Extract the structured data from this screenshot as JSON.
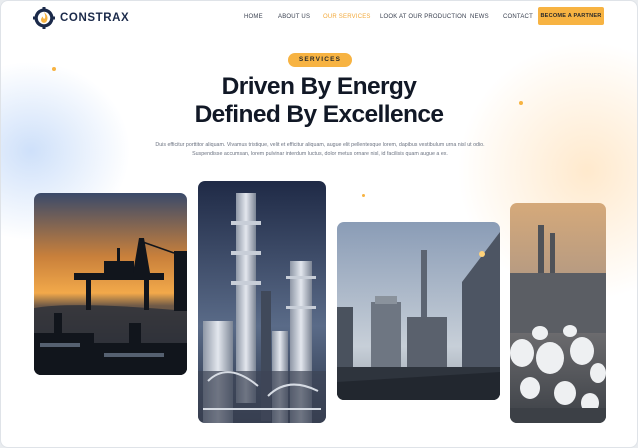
{
  "brand": {
    "name": "CONSTRAX",
    "logo_icon": "gear-flame-logo-icon"
  },
  "nav": {
    "items": [
      {
        "label": "HOME",
        "active": false
      },
      {
        "label": "ABOUT US",
        "active": false
      },
      {
        "label": "OUR SERVICES",
        "active": true
      },
      {
        "label": "LOOK AT OUR PRODUCTION",
        "active": false
      },
      {
        "label": "NEWS",
        "active": false
      },
      {
        "label": "CONTACT",
        "active": false
      }
    ],
    "cta_label": "BECOME A PARTNER"
  },
  "hero": {
    "badge": "SERVICES",
    "headline_line1": "Driven By Energy",
    "headline_line2": "Defined By Excellence",
    "lead": "Duis efficitur porttitor aliquam. Vivamus tristique, velit et efficitur aliquam, augue elit pellentesque lorem, dapibus vestibulum urna nisl ut odio. Suspendisse accumsan, lorem pulvinar interdum luctus, dolor metus ornare nisl, id facilisis quam augue a ex."
  },
  "photos": [
    {
      "subject": "offshore-oil-rig-sunset"
    },
    {
      "subject": "refinery-distillation-towers"
    },
    {
      "subject": "industrial-plant-dusk"
    },
    {
      "subject": "refinery-storage-tanks-aerial"
    }
  ],
  "colors": {
    "accent": "#f7b342",
    "accent_text": "#f2a93b",
    "heading": "#111826",
    "body_text": "#6b7280"
  }
}
